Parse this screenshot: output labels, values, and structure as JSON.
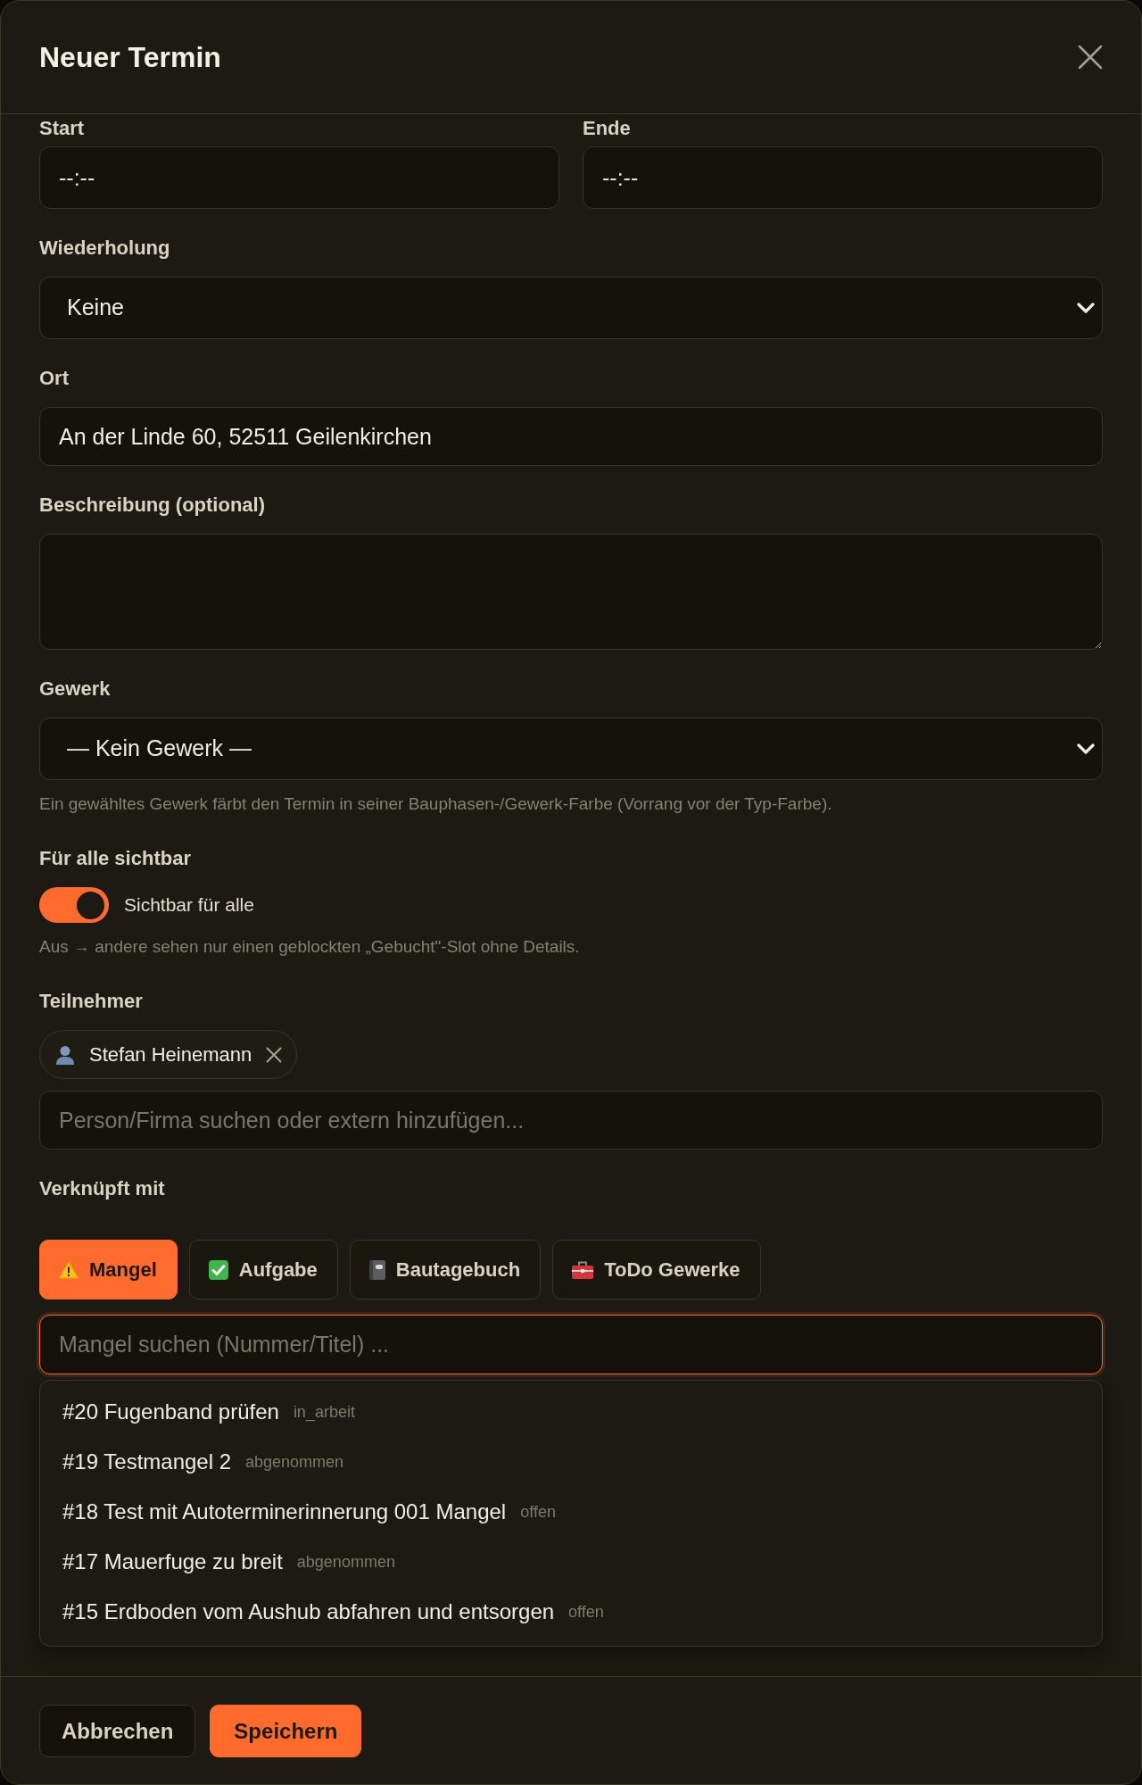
{
  "dialog": {
    "title": "Neuer Termin"
  },
  "time_fields": [
    {
      "label": "Start",
      "placeholder": "--:--"
    },
    {
      "label": "Ende",
      "placeholder": "--:--"
    }
  ],
  "repeat": {
    "label": "Wiederholung",
    "value": "Keine"
  },
  "location": {
    "label": "Ort",
    "value": "An der Linde 60, 52511 Geilenkirchen"
  },
  "description": {
    "label": "Beschreibung (optional)"
  },
  "trade": {
    "label": "Gewerk",
    "value": "— Kein Gewerk —",
    "help": "Ein gewähltes Gewerk färbt den Termin in seiner Bauphasen-/Gewerk-Farbe (Vorrang vor der Typ-Farbe)."
  },
  "visibility": {
    "label": "Für alle sichtbar",
    "switch_label": "Sichtbar für alle",
    "on": true,
    "help": "Aus → andere sehen nur einen geblockten „Gebucht\"-Slot ohne Details."
  },
  "participants": {
    "label": "Teilnehmer",
    "chips": [
      {
        "name": "Stefan Heinemann"
      }
    ],
    "search": {
      "placeholder": "Person/Firma suchen oder extern hinzufügen..."
    }
  },
  "links": {
    "label": "Verknüpft mit",
    "tabs": [
      {
        "label": "Mangel",
        "kind": "defect",
        "selected": true
      },
      {
        "label": "Aufgabe",
        "kind": "task",
        "selected": false
      },
      {
        "label": "Bautagebuch",
        "kind": "diary",
        "selected": false
      },
      {
        "label": "ToDo Gewerke",
        "kind": "todo",
        "selected": false
      }
    ],
    "search": {
      "placeholder": "Mangel suchen (Nummer/Titel) ...",
      "focused": true
    },
    "results": [
      {
        "title": "#20 Fugenband prüfen",
        "status": "in_arbeit"
      },
      {
        "title": "#19 Testmangel 2",
        "status": "abgenommen"
      },
      {
        "title": "#18 Test mit Autoterminerinnerung 001 Mangel",
        "status": "offen"
      },
      {
        "title": "#17 Mauerfuge zu breit",
        "status": "abgenommen"
      },
      {
        "title": "#15 Erdboden vom Aushub abfahren und entsorgen",
        "status": "offen"
      }
    ]
  },
  "buttons": [
    {
      "label": "Abbrechen",
      "kind": "secondary"
    },
    {
      "label": "Speichern",
      "kind": "primary"
    }
  ]
}
